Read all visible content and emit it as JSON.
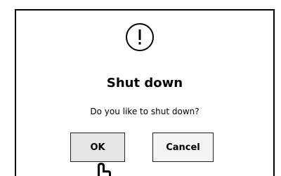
{
  "dialog": {
    "icon": "exclamation-icon",
    "title": "Shut down",
    "message": "Do you like to shut down?",
    "ok_label": "OK",
    "cancel_label": "Cancel"
  },
  "cursor": {
    "icon": "hand-pointer-cursor-icon"
  },
  "colors": {
    "ok_button_bg": "#e6e6e6",
    "cancel_button_bg": "#f3f3f3",
    "border": "#000000"
  }
}
